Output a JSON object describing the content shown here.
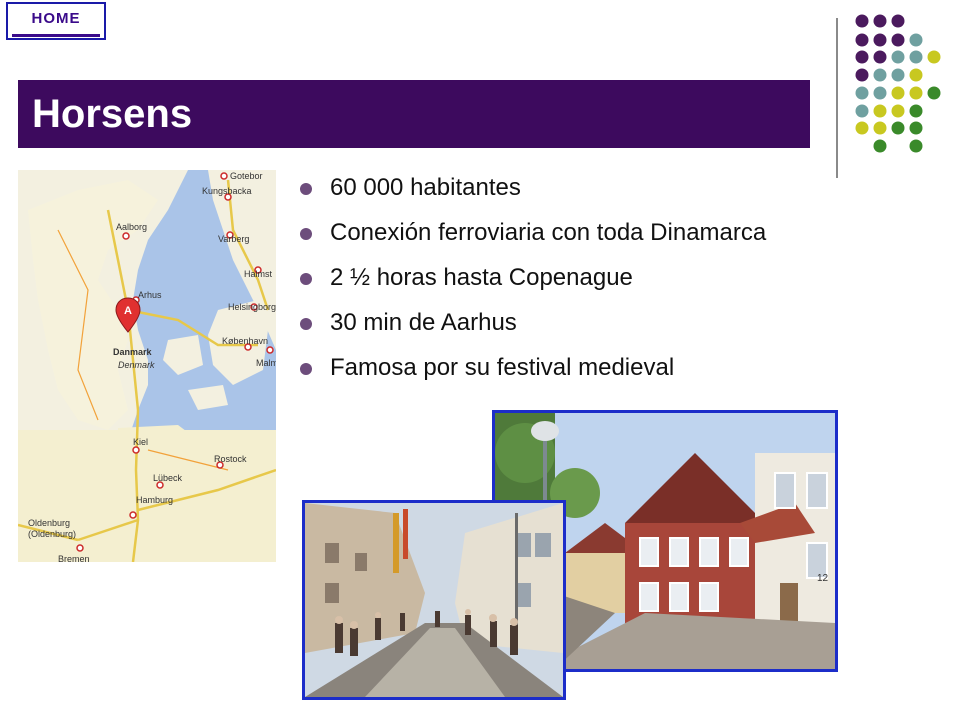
{
  "nav": {
    "home_label": "HOME"
  },
  "slide": {
    "title": "Horsens",
    "bullets": [
      "60 000 habitantes",
      "Conexión ferroviaria con toda Dinamarca",
      "2 ½ horas hasta Copenague",
      "30 min de Aarhus",
      "Famosa por su festival medieval"
    ]
  },
  "map": {
    "labels": {
      "gothenburg": "Gotebor",
      "kungsbacka": "Kungsbacka",
      "aalborg": "Aalborg",
      "varberg": "Varberg",
      "halmstad": "Halmst",
      "arhus": "Arhus",
      "helsingborg": "Helsingborg",
      "kobenhavn": "København",
      "danmark": "Danmark",
      "denmark": "Denmark",
      "malmo": "Malm",
      "kiel": "Kiel",
      "rostock": "Rostock",
      "lubeck": "Lübeck",
      "hamburg": "Hamburg",
      "oldenburg": "Oldenburg",
      "oldenburg_paren": "(Oldenburg)",
      "bremen": "Bremen"
    },
    "marker_letter": "A"
  },
  "photos": {
    "street_back_sign": "12"
  },
  "colors": {
    "title_bar": "#3d0a5e",
    "home_border": "#1a1aa8",
    "photo_border": "#1c2dc9",
    "bullet": "#6d4d7c",
    "dot_purple": "#4b1a5e",
    "dot_teal": "#6fa0a0",
    "dot_yellow": "#c8c820",
    "dot_green": "#3a8a2a"
  }
}
